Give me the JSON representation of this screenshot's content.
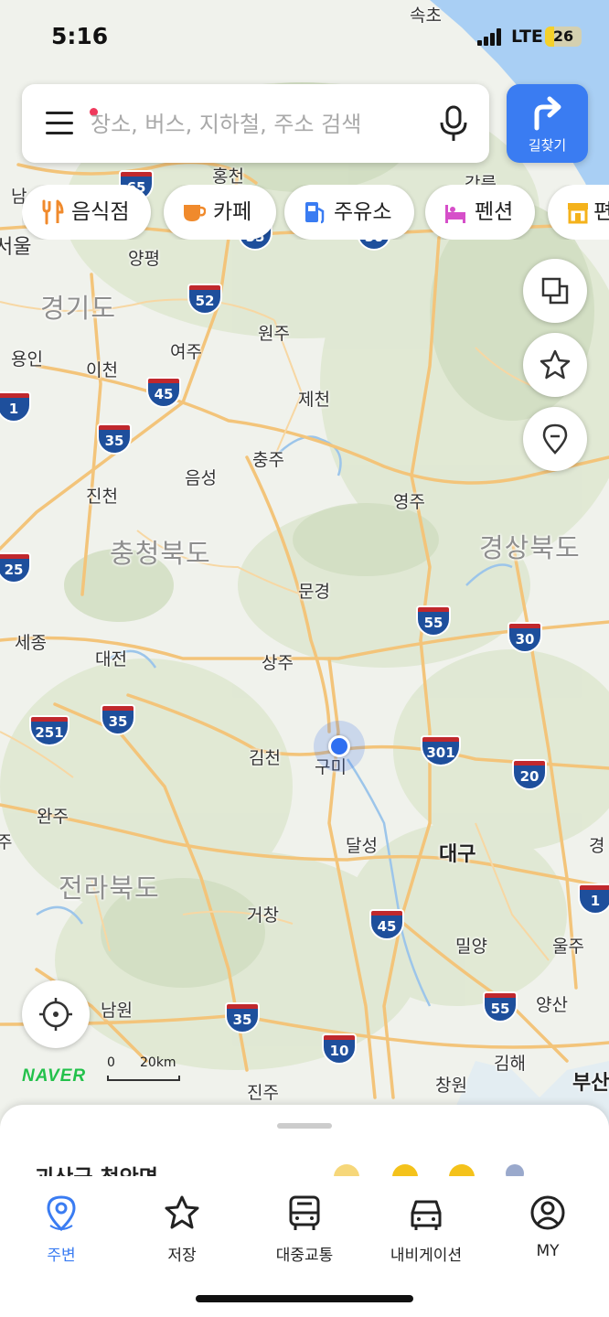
{
  "status_bar": {
    "time": "5:16",
    "network": "LTE",
    "battery": "26",
    "battery_level": 0.26
  },
  "search": {
    "placeholder": "장소, 버스, 지하철, 주소 검색"
  },
  "route_button": {
    "label": "길찾기"
  },
  "categories": [
    {
      "label": "음식점",
      "icon": "fork-knife-icon",
      "color": "#f08a2c"
    },
    {
      "label": "카페",
      "icon": "coffee-cup-icon",
      "color": "#f08a2c"
    },
    {
      "label": "주유소",
      "icon": "gas-station-icon",
      "color": "#3a7cf2"
    },
    {
      "label": "펜션",
      "icon": "bed-icon",
      "color": "#d64fc9"
    },
    {
      "label": "편",
      "icon": "store-icon",
      "color": "#f4b21b"
    }
  ],
  "map": {
    "regions": [
      "경기도",
      "충청북도",
      "경상북도",
      "전라북도"
    ],
    "places": [
      "속초",
      "홍천",
      "강릉",
      "서울",
      "양평",
      "원주",
      "용인",
      "여주",
      "이천",
      "제천",
      "충주",
      "음성",
      "진천",
      "영주",
      "문경",
      "세종",
      "대전",
      "상주",
      "김천",
      "구미",
      "완주",
      "달성",
      "대구",
      "거창",
      "밀양",
      "울주",
      "남원",
      "양산",
      "김해",
      "창원",
      "진주",
      "부산",
      "남",
      "경",
      "주"
    ],
    "bold_places": [
      "대구",
      "부산"
    ],
    "highways": [
      "65",
      "55",
      "50",
      "52",
      "45",
      "1",
      "35",
      "25",
      "55",
      "30",
      "251",
      "35",
      "301",
      "20",
      "1",
      "45",
      "55",
      "35",
      "10"
    ],
    "brand": "NAVER",
    "scale": {
      "zero": "0",
      "distance": "20km"
    }
  },
  "side_buttons": [
    {
      "icon": "layers-icon"
    },
    {
      "icon": "star-icon"
    },
    {
      "icon": "location-pin-icon"
    }
  ],
  "bottom_sheet": {
    "title": "괴산군 청안면"
  },
  "tabs": [
    {
      "label": "주변",
      "icon": "nearby-pin-icon",
      "active": true
    },
    {
      "label": "저장",
      "icon": "star-icon",
      "active": false
    },
    {
      "label": "대중교통",
      "icon": "bus-icon",
      "active": false
    },
    {
      "label": "내비게이션",
      "icon": "car-icon",
      "active": false
    },
    {
      "label": "MY",
      "icon": "user-icon",
      "active": false
    }
  ]
}
